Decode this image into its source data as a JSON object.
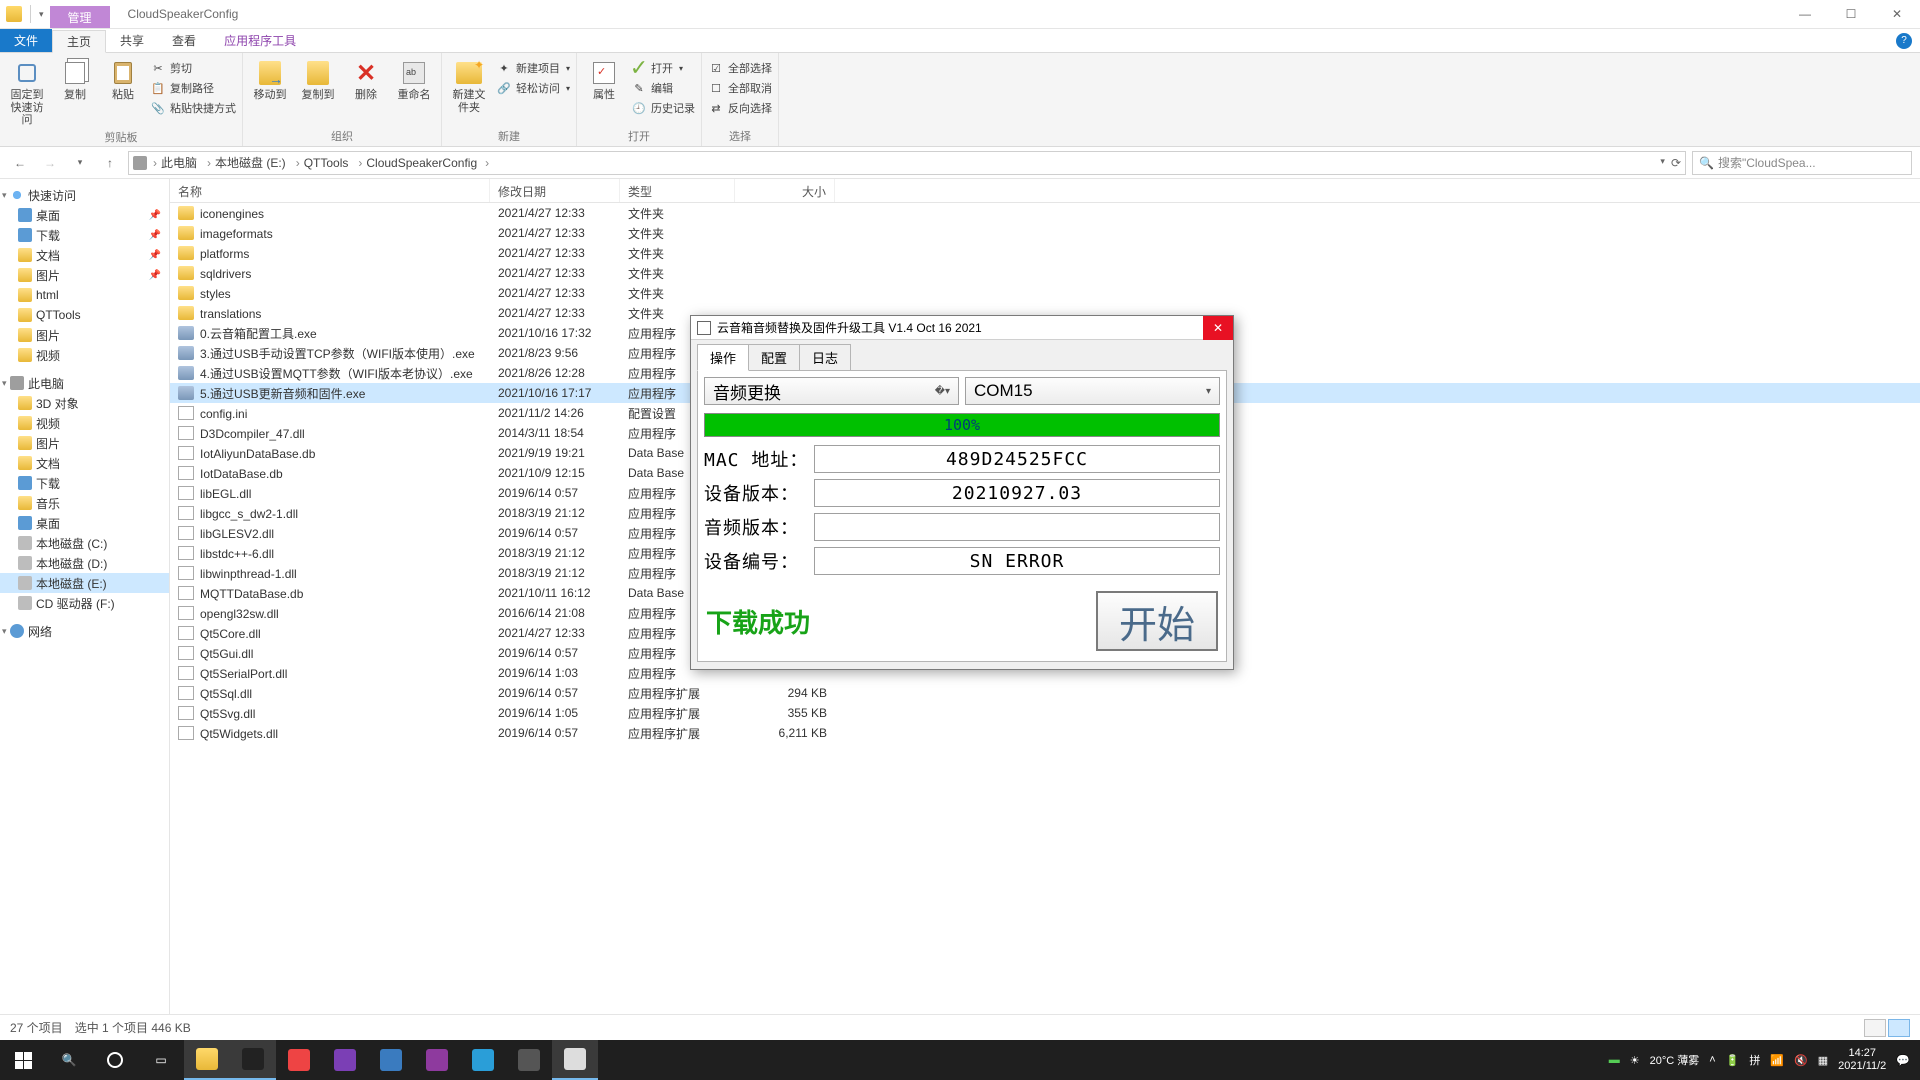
{
  "window": {
    "context_tab": "管理",
    "title": "CloudSpeakerConfig",
    "min": "—",
    "max": "☐",
    "close": "✕"
  },
  "ribbon_tabs": {
    "file": "文件",
    "home": "主页",
    "share": "共享",
    "view": "查看",
    "app_tools": "应用程序工具"
  },
  "ribbon": {
    "clipboard": {
      "pin": "固定到快速访问",
      "copy": "复制",
      "paste": "粘贴",
      "cut": "剪切",
      "copy_path": "复制路径",
      "paste_shortcut": "粘贴快捷方式",
      "label": "剪贴板"
    },
    "organize": {
      "move_to": "移动到",
      "copy_to": "复制到",
      "delete": "删除",
      "rename": "重命名",
      "label": "组织"
    },
    "new": {
      "new_folder": "新建文件夹",
      "new_item": "新建项目",
      "easy_access": "轻松访问",
      "label": "新建"
    },
    "open": {
      "properties": "属性",
      "open": "打开",
      "edit": "编辑",
      "history": "历史记录",
      "label": "打开"
    },
    "select": {
      "select_all": "全部选择",
      "select_none": "全部取消",
      "invert": "反向选择",
      "label": "选择"
    }
  },
  "breadcrumbs": [
    "此电脑",
    "本地磁盘 (E:)",
    "QTTools",
    "CloudSpeakerConfig"
  ],
  "search_placeholder": "搜索\"CloudSpea...",
  "columns": {
    "name": "名称",
    "date": "修改日期",
    "type": "类型",
    "size": "大小"
  },
  "nav": {
    "quick_access": "快速访问",
    "quick_items": [
      {
        "label": "桌面",
        "icon": "desktop",
        "pin": true
      },
      {
        "label": "下载",
        "icon": "dl",
        "pin": true
      },
      {
        "label": "文档",
        "icon": "folder",
        "pin": true
      },
      {
        "label": "图片",
        "icon": "folder",
        "pin": true
      },
      {
        "label": "html",
        "icon": "folder",
        "pin": false
      },
      {
        "label": "QTTools",
        "icon": "folder",
        "pin": false
      },
      {
        "label": "图片",
        "icon": "folder",
        "pin": false
      },
      {
        "label": "视频",
        "icon": "folder",
        "pin": false
      }
    ],
    "this_pc": "此电脑",
    "pc_items": [
      {
        "label": "3D 对象",
        "icon": "folder"
      },
      {
        "label": "视频",
        "icon": "folder"
      },
      {
        "label": "图片",
        "icon": "folder"
      },
      {
        "label": "文档",
        "icon": "folder"
      },
      {
        "label": "下载",
        "icon": "dl"
      },
      {
        "label": "音乐",
        "icon": "folder"
      },
      {
        "label": "桌面",
        "icon": "desktop"
      },
      {
        "label": "本地磁盘 (C:)",
        "icon": "drive"
      },
      {
        "label": "本地磁盘 (D:)",
        "icon": "drive"
      },
      {
        "label": "本地磁盘 (E:)",
        "icon": "drive",
        "selected": true
      },
      {
        "label": "CD 驱动器 (F:)",
        "icon": "drive"
      }
    ],
    "network": "网络"
  },
  "files": [
    {
      "name": "iconengines",
      "date": "2021/4/27 12:33",
      "type": "文件夹",
      "size": "",
      "icon": "folder"
    },
    {
      "name": "imageformats",
      "date": "2021/4/27 12:33",
      "type": "文件夹",
      "size": "",
      "icon": "folder"
    },
    {
      "name": "platforms",
      "date": "2021/4/27 12:33",
      "type": "文件夹",
      "size": "",
      "icon": "folder"
    },
    {
      "name": "sqldrivers",
      "date": "2021/4/27 12:33",
      "type": "文件夹",
      "size": "",
      "icon": "folder"
    },
    {
      "name": "styles",
      "date": "2021/4/27 12:33",
      "type": "文件夹",
      "size": "",
      "icon": "folder"
    },
    {
      "name": "translations",
      "date": "2021/4/27 12:33",
      "type": "文件夹",
      "size": "",
      "icon": "folder"
    },
    {
      "name": "0.云音箱配置工具.exe",
      "date": "2021/10/16 17:32",
      "type": "应用程序",
      "size": "",
      "icon": "exe"
    },
    {
      "name": "3.通过USB手动设置TCP参数（WIFI版本使用）.exe",
      "date": "2021/8/23 9:56",
      "type": "应用程序",
      "size": "",
      "icon": "exe"
    },
    {
      "name": "4.通过USB设置MQTT参数（WIFI版本老协议）.exe",
      "date": "2021/8/26 12:28",
      "type": "应用程序",
      "size": "",
      "icon": "exe"
    },
    {
      "name": "5.通过USB更新音频和固件.exe",
      "date": "2021/10/16 17:17",
      "type": "应用程序",
      "size": "",
      "icon": "exe",
      "selected": true
    },
    {
      "name": "config.ini",
      "date": "2021/11/2 14:26",
      "type": "配置设置",
      "size": "",
      "icon": "file"
    },
    {
      "name": "D3Dcompiler_47.dll",
      "date": "2014/3/11 18:54",
      "type": "应用程序",
      "size": "",
      "icon": "file"
    },
    {
      "name": "IotAliyunDataBase.db",
      "date": "2021/9/19 19:21",
      "type": "Data Base",
      "size": "",
      "icon": "file"
    },
    {
      "name": "IotDataBase.db",
      "date": "2021/10/9 12:15",
      "type": "Data Base",
      "size": "",
      "icon": "file"
    },
    {
      "name": "libEGL.dll",
      "date": "2019/6/14 0:57",
      "type": "应用程序",
      "size": "",
      "icon": "file"
    },
    {
      "name": "libgcc_s_dw2-1.dll",
      "date": "2018/3/19 21:12",
      "type": "应用程序",
      "size": "",
      "icon": "file"
    },
    {
      "name": "libGLESV2.dll",
      "date": "2019/6/14 0:57",
      "type": "应用程序",
      "size": "",
      "icon": "file"
    },
    {
      "name": "libstdc++-6.dll",
      "date": "2018/3/19 21:12",
      "type": "应用程序",
      "size": "",
      "icon": "file"
    },
    {
      "name": "libwinpthread-1.dll",
      "date": "2018/3/19 21:12",
      "type": "应用程序",
      "size": "",
      "icon": "file"
    },
    {
      "name": "MQTTDataBase.db",
      "date": "2021/10/11 16:12",
      "type": "Data Base",
      "size": "",
      "icon": "file"
    },
    {
      "name": "opengl32sw.dll",
      "date": "2016/6/14 21:08",
      "type": "应用程序",
      "size": "",
      "icon": "file"
    },
    {
      "name": "Qt5Core.dll",
      "date": "2021/4/27 12:33",
      "type": "应用程序",
      "size": "",
      "icon": "file"
    },
    {
      "name": "Qt5Gui.dll",
      "date": "2019/6/14 0:57",
      "type": "应用程序",
      "size": "",
      "icon": "file"
    },
    {
      "name": "Qt5SerialPort.dll",
      "date": "2019/6/14 1:03",
      "type": "应用程序",
      "size": "",
      "icon": "file"
    },
    {
      "name": "Qt5Sql.dll",
      "date": "2019/6/14 0:57",
      "type": "应用程序扩展",
      "size": "294 KB",
      "icon": "file"
    },
    {
      "name": "Qt5Svg.dll",
      "date": "2019/6/14 1:05",
      "type": "应用程序扩展",
      "size": "355 KB",
      "icon": "file"
    },
    {
      "name": "Qt5Widgets.dll",
      "date": "2019/6/14 0:57",
      "type": "应用程序扩展",
      "size": "6,211 KB",
      "icon": "file"
    }
  ],
  "status": {
    "count": "27 个项目",
    "selection": "选中 1 个项目  446 KB"
  },
  "dialog": {
    "title": "云音箱音频替换及固件升级工具 V1.4 Oct 16 2021",
    "tabs": {
      "op": "操作",
      "cfg": "配置",
      "log": "日志"
    },
    "mode": "音频更换",
    "port": "COM15",
    "progress": "100%",
    "mac_label": "MAC 地址：",
    "mac_value": "489D24525FCC",
    "dev_ver_label": "设备版本：",
    "dev_ver_value": "20210927.03",
    "audio_ver_label": "音频版本：",
    "audio_ver_value": "",
    "dev_id_label": "设备编号：",
    "dev_id_value": "SN ERROR",
    "status_text": "下载成功",
    "start": "开始"
  },
  "taskbar": {
    "weather": "20°C 薄雾",
    "time": "14:27",
    "date": "2021/11/2"
  }
}
